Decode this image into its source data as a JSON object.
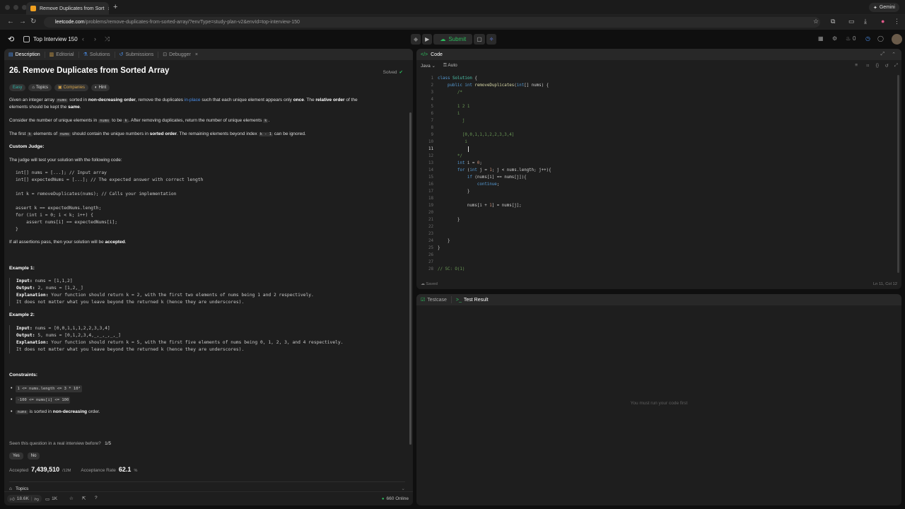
{
  "browser": {
    "tab_title": "Remove Duplicates from Sort",
    "tab_close": "×",
    "new_tab": "+",
    "url_host": "leetcode.com",
    "url_path": "/problems/remove-duplicates-from-sorted-array/?envType=study-plan-v2&envId=top-interview-150",
    "gemini_label": "Gemini"
  },
  "header": {
    "list_title": "Top Interview 150",
    "submit_label": "Submit",
    "notif_count": "0"
  },
  "left_tabs": [
    "Description",
    "Editorial",
    "Solutions",
    "Submissions",
    "Debugger"
  ],
  "problem": {
    "title": "26. Remove Duplicates from Sorted Array",
    "status": "Solved",
    "tags": [
      "Easy",
      "Topics",
      "Companies",
      "Hint"
    ],
    "p1": [
      "Given an integer array ",
      "nums",
      " sorted in ",
      "non-decreasing order",
      ", remove the duplicates ",
      "in-place",
      " such that each unique element appears only ",
      "once",
      ". The ",
      "relative order",
      " of the"
    ],
    "p1b": [
      "elements should be kept the ",
      "same",
      "."
    ],
    "p2": [
      "Consider the number of unique elements in ",
      "nums",
      " to be ",
      "k",
      ". After removing duplicates, return the number of unique elements ",
      "k",
      "."
    ],
    "p3": [
      "The first ",
      "k",
      " elements of ",
      "nums",
      " should contain the unique numbers in ",
      "sorted order",
      ". The remaining elements beyond index ",
      "k - 1",
      " can be ignored."
    ],
    "custom_judge": "Custom Judge:",
    "judge_text": "The judge will test your solution with the following code:",
    "judge_code": "int[] nums = [...]; // Input array\nint[] expectedNums = [...]; // The expected answer with correct length\n\nint k = removeDuplicates(nums); // Calls your implementation\n\nassert k == expectedNums.length;\nfor (int i = 0; i < k; i++) {\n    assert nums[i] == expectedNums[i];\n}",
    "accept_text": [
      "If all assertions pass, then your solution will be ",
      "accepted",
      "."
    ],
    "example1_title": "Example 1:",
    "example1": {
      "input_label": "Input:",
      "input": " nums = [1,1,2]",
      "output_label": "Output:",
      "output": " 2, nums = [1,2,_]",
      "expl_label": "Explanation:",
      "expl": " Your function should return k = 2, with the first two elements of nums being 1 and 2 respectively.",
      "expl2": "It does not matter what you leave beyond the returned k (hence they are underscores)."
    },
    "example2_title": "Example 2:",
    "example2": {
      "input_label": "Input:",
      "input": " nums = [0,0,1,1,1,2,2,3,3,4]",
      "output_label": "Output:",
      "output": " 5, nums = [0,1,2,3,4,_,_,_,_,_]",
      "expl_label": "Explanation:",
      "expl": " Your function should return k = 5, with the first five elements of nums being 0, 1, 2, 3, and 4 respectively.",
      "expl2": "It does not matter what you leave beyond the returned k (hence they are underscores)."
    },
    "constraints_title": "Constraints:",
    "constraints": [
      "1 <= nums.length <= 3 * 10⁴",
      "-100 <= nums[i] <= 100"
    ],
    "constraint3": [
      "nums",
      " is sorted in ",
      "non-decreasing",
      " order."
    ],
    "seen_q": "Seen this question in a real interview before?",
    "seen_count": "1/5",
    "yes": "Yes",
    "no": "No",
    "accepted_label": "Accepted",
    "accepted_value": "7,439,510",
    "accepted_total": "/12M",
    "rate_label": "Acceptance Rate",
    "rate_value": "62.1",
    "rate_unit": "%",
    "topics_label": "Topics"
  },
  "left_footer": {
    "likes": "18.6K",
    "comments": "1K",
    "online": "660 Online"
  },
  "code_panel": {
    "title": "Code",
    "language": "Java",
    "auto": "Auto",
    "saved": "Saved",
    "position": "Ln 11, Col 12",
    "line_numbers": [
      "1",
      "2",
      "3",
      "4",
      "5",
      "6",
      "7",
      "8",
      "9",
      "10",
      "11",
      "12",
      "13",
      "14",
      "15",
      "16",
      "17",
      "18",
      "19",
      "20",
      "21",
      "22",
      "23",
      "24",
      "25",
      "26",
      "27",
      "28"
    ]
  },
  "test_panel": {
    "tabs": [
      "Testcase",
      "Test Result"
    ],
    "empty_message": "You must run your code first"
  },
  "colors": {
    "accent_green": "#2cbb5d",
    "easy": "#2cb5a8",
    "link": "#4a8de8"
  }
}
